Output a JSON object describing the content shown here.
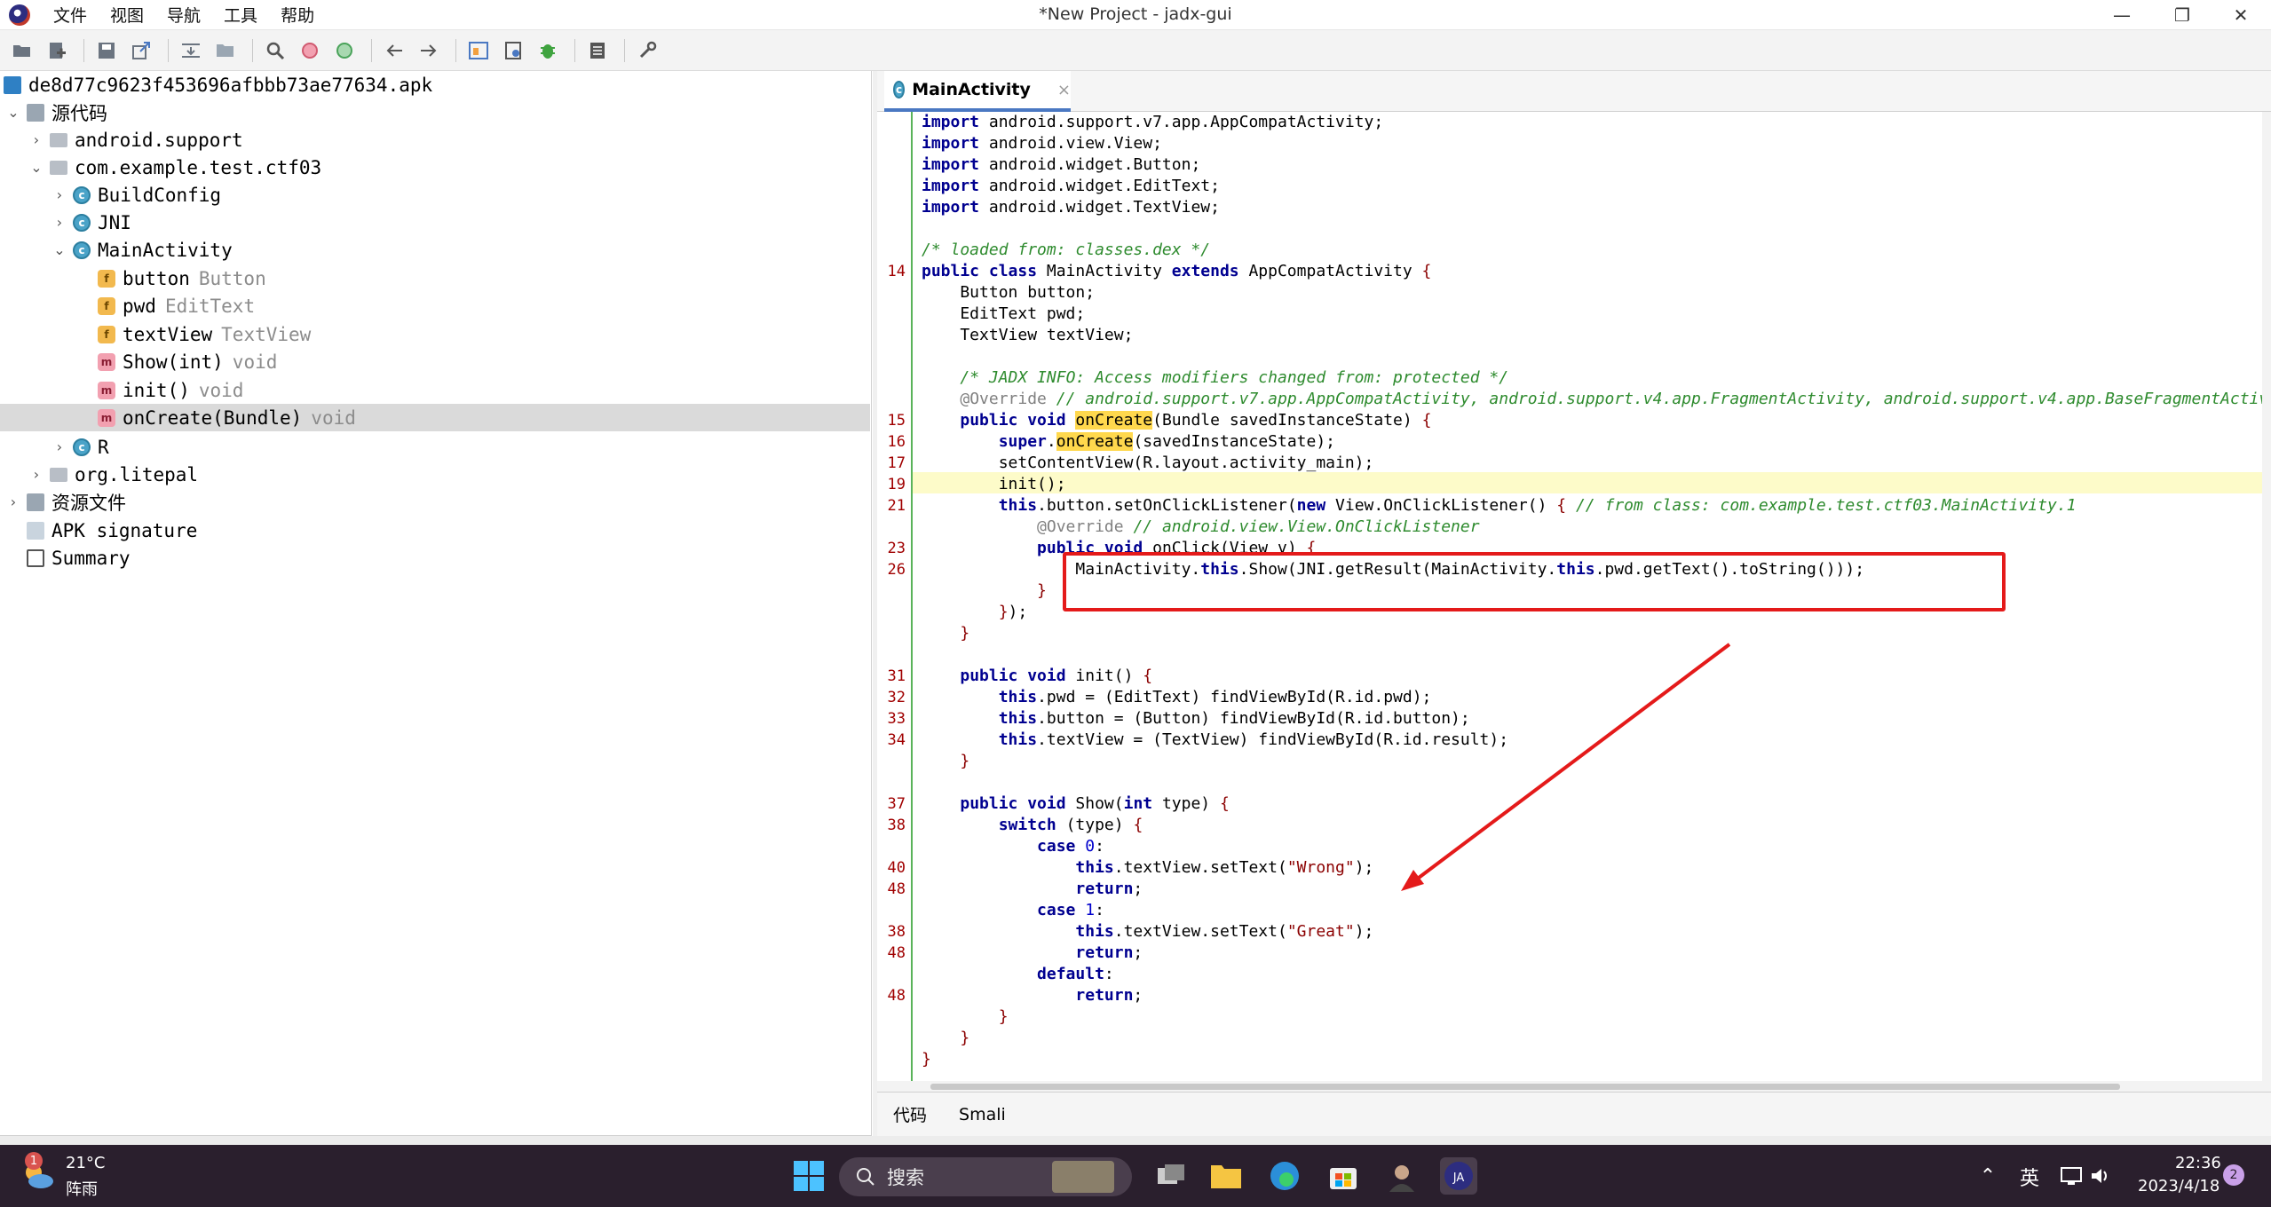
{
  "window": {
    "title": "*New Project - jadx-gui",
    "menu": [
      "文件",
      "视图",
      "导航",
      "工具",
      "帮助"
    ],
    "controls": {
      "minimize": "—",
      "restore": "❐",
      "close": "✕"
    }
  },
  "toolbar": {
    "buttons": [
      "open-icon",
      "add-files-icon",
      "save-icon",
      "export-icon",
      "sync-icon",
      "flatten-icon",
      "search-icon",
      "find-class-icon",
      "find-usage-icon",
      "back-icon",
      "forward-icon",
      "deobf-icon",
      "quark-icon",
      "debug-icon",
      "log-icon",
      "preferences-icon"
    ]
  },
  "tree": {
    "root": "de8d77c9623f453696afbbb73ae77634.apk",
    "source_code": "源代码",
    "packages": {
      "android_support": "android.support",
      "com_example": "com.example.test.ctf03",
      "org_litepal": "org.litepal"
    },
    "classes": {
      "build_config": "BuildConfig",
      "jni": "JNI",
      "main_activity": "MainActivity",
      "r": "R"
    },
    "members": [
      {
        "name": "button",
        "type": "Button",
        "kind": "f"
      },
      {
        "name": "pwd",
        "type": "EditText",
        "kind": "f"
      },
      {
        "name": "textView",
        "type": "TextView",
        "kind": "f"
      },
      {
        "name": "Show(int)",
        "type": "void",
        "kind": "m"
      },
      {
        "name": "init()",
        "type": "void",
        "kind": "m"
      },
      {
        "name": "onCreate(Bundle)",
        "type": "void",
        "kind": "m"
      }
    ],
    "resources": "资源文件",
    "apk_signature": "APK signature",
    "summary": "Summary"
  },
  "editor": {
    "tab": "MainActivity",
    "tab_close": "×",
    "bottom_tabs": [
      "代码",
      "Smali"
    ],
    "line_numbers": [
      {
        "row": 7,
        "n": "14"
      },
      {
        "row": 14,
        "n": "15"
      },
      {
        "row": 15,
        "n": "16"
      },
      {
        "row": 16,
        "n": "17"
      },
      {
        "row": 17,
        "n": "19"
      },
      {
        "row": 18,
        "n": "21"
      },
      {
        "row": 20,
        "n": "23"
      },
      {
        "row": 21,
        "n": "26"
      },
      {
        "row": 26,
        "n": "31"
      },
      {
        "row": 27,
        "n": "32"
      },
      {
        "row": 28,
        "n": "33"
      },
      {
        "row": 29,
        "n": "34"
      },
      {
        "row": 32,
        "n": "37"
      },
      {
        "row": 33,
        "n": "38"
      },
      {
        "row": 35,
        "n": "40"
      },
      {
        "row": 36,
        "n": "48"
      },
      {
        "row": 38,
        "n": "38"
      },
      {
        "row": 39,
        "n": "48"
      },
      {
        "row": 41,
        "n": "48"
      }
    ]
  },
  "taskbar": {
    "weather_temp": "21°C",
    "weather_desc": "阵雨",
    "weather_badge": "1",
    "search": "搜索",
    "ime": "英",
    "time": "22:36",
    "date": "2023/4/18",
    "notification_count": "2"
  },
  "colors": {
    "accent": "#4a78c2",
    "annotation": "#e41a1a",
    "highlight": "#fdfbc9",
    "gutter_line": "#5ab35a"
  }
}
